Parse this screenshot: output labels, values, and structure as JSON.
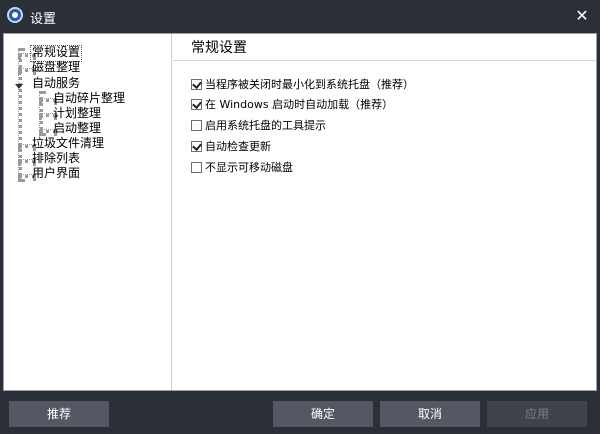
{
  "window": {
    "title": "设置"
  },
  "tree": {
    "items": [
      {
        "label": "常规设置"
      },
      {
        "label": "磁盘整理"
      },
      {
        "label": "自动服务"
      },
      {
        "label": "自动碎片整理"
      },
      {
        "label": "计划整理"
      },
      {
        "label": "启动整理"
      },
      {
        "label": "垃圾文件清理"
      },
      {
        "label": "排除列表"
      },
      {
        "label": "用户界面"
      }
    ],
    "selected": "常规设置"
  },
  "panel": {
    "title": "常规设置",
    "options": [
      {
        "label": "当程序被关闭时最小化到系统托盘（推荐）",
        "checked": true
      },
      {
        "label": "在 Windows 启动时自动加载（推荐）",
        "checked": true
      },
      {
        "label": "启用系统托盘的工具提示",
        "checked": false
      },
      {
        "label": "自动检查更新",
        "checked": true
      },
      {
        "label": "不显示可移动磁盘",
        "checked": false
      }
    ]
  },
  "footer": {
    "recommend_label": "推荐",
    "ok_label": "确定",
    "cancel_label": "取消",
    "apply_label": "应用",
    "apply_enabled": false
  },
  "colors": {
    "chrome": "#2b2f37",
    "button": "#535862",
    "button_disabled": "#3f434b",
    "content_bg": "#ffffff"
  },
  "icons": {
    "app": "app-logo-icon",
    "close": "close-icon",
    "expand": "expand-triangle-icon",
    "checkbox_checked": "checkmark-icon"
  }
}
